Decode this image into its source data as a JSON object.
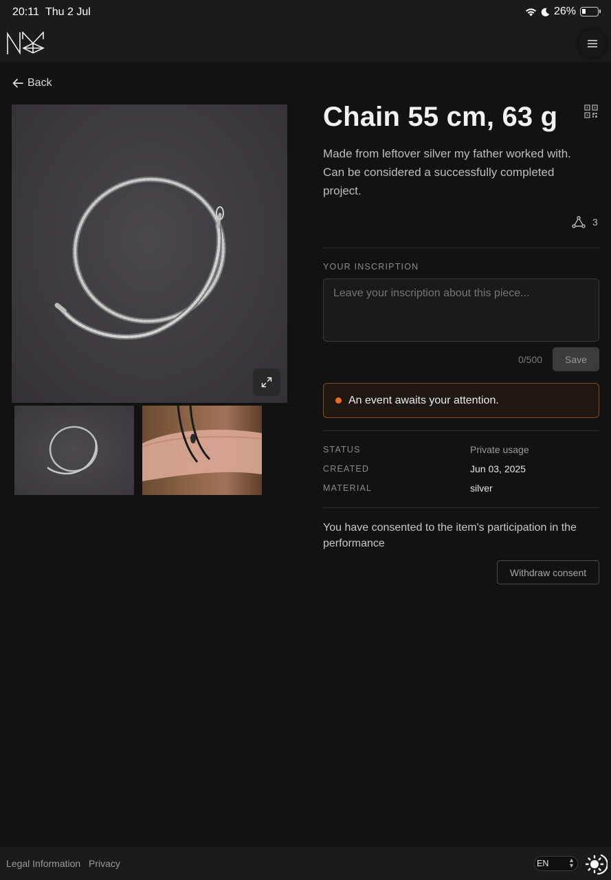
{
  "status_bar": {
    "time": "20:11",
    "date": "Thu 2 Jul",
    "battery": "26%",
    "battery_level": 0.26
  },
  "header": {
    "logo_icon": "nm-logo-icon",
    "menu_icon": "hamburger-icon"
  },
  "nav": {
    "back_label": "Back"
  },
  "item": {
    "title": "Chain 55 cm, 63 g",
    "description": "Made from leftover silver my father worked with. Can be considered a successfully completed project.",
    "share_count": "3"
  },
  "inscription": {
    "label": "YOUR INSCRIPTION",
    "placeholder": "Leave your inscription about this piece...",
    "value": "",
    "counter": "0/500",
    "save_label": "Save"
  },
  "alert": {
    "message": "An event awaits your attention.",
    "color": "#f06a1f"
  },
  "meta": {
    "status_label": "STATUS",
    "status_value": "Private usage",
    "created_label": "CREATED",
    "created_value": "Jun 03, 2025",
    "material_label": "MATERIAL",
    "material_value": "silver"
  },
  "consent": {
    "text": "You have consented to the item's participation in the performance",
    "withdraw_label": "Withdraw consent"
  },
  "footer": {
    "legal_label": "Legal Information",
    "privacy_label": "Privacy",
    "language": "EN"
  }
}
